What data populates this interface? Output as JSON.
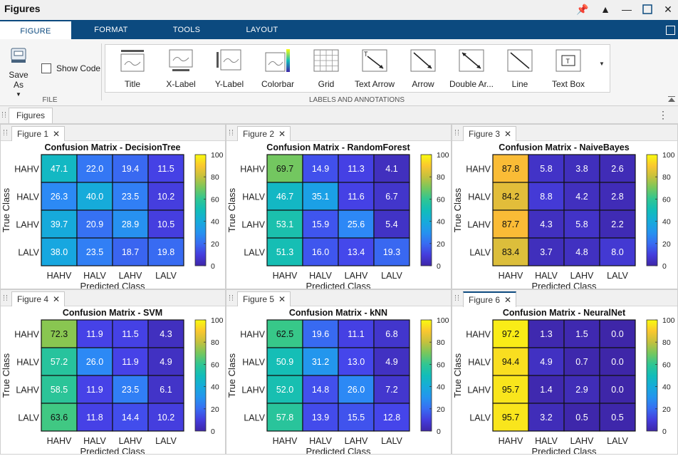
{
  "window": {
    "title": "Figures"
  },
  "tabs": [
    {
      "label": "FIGURE",
      "active": true
    },
    {
      "label": "FORMAT",
      "active": false
    },
    {
      "label": "TOOLS",
      "active": false
    },
    {
      "label": "LAYOUT",
      "active": false
    }
  ],
  "ribbon": {
    "save_as": "Save As",
    "show_code": "Show Code",
    "file_group": "FILE",
    "annotations_group": "LABELS AND ANNOTATIONS",
    "gallery": [
      "Title",
      "X-Label",
      "Y-Label",
      "Colorbar",
      "Grid",
      "Text Arrow",
      "Arrow",
      "Double Ar...",
      "Line",
      "Text Box"
    ]
  },
  "document_tab": "Figures",
  "colors": {
    "accent": "#0c4a7f",
    "cell_border": "#111111"
  },
  "colormap": "parula",
  "chart_data": [
    {
      "figure_tab": "Figure 1",
      "type": "heatmap",
      "title": "Confusion Matrix - DecisionTree",
      "xlabel": "Predicted Class",
      "ylabel": "True Class",
      "x_categories": [
        "HAHV",
        "HALV",
        "LAHV",
        "LALV"
      ],
      "y_categories": [
        "HAHV",
        "HALV",
        "LAHV",
        "LALV"
      ],
      "values": [
        [
          47.1,
          22.0,
          19.4,
          11.5
        ],
        [
          26.3,
          40.0,
          23.5,
          10.2
        ],
        [
          39.7,
          20.9,
          28.9,
          10.5
        ],
        [
          38.0,
          23.5,
          18.7,
          19.8
        ]
      ],
      "colorbar_ticks": [
        "100",
        "80",
        "60",
        "40",
        "20",
        "0"
      ],
      "clim": [
        0,
        100
      ]
    },
    {
      "figure_tab": "Figure 2",
      "type": "heatmap",
      "title": "Confusion Matrix - RandomForest",
      "xlabel": "Predicted Class",
      "ylabel": "True Class",
      "x_categories": [
        "HAHV",
        "HALV",
        "LAHV",
        "LALV"
      ],
      "y_categories": [
        "HAHV",
        "HALV",
        "LAHV",
        "LALV"
      ],
      "values": [
        [
          69.7,
          14.9,
          11.3,
          4.1
        ],
        [
          46.7,
          35.1,
          11.6,
          6.7
        ],
        [
          53.1,
          15.9,
          25.6,
          5.4
        ],
        [
          51.3,
          16.0,
          13.4,
          19.3
        ]
      ],
      "colorbar_ticks": [
        "100",
        "80",
        "60",
        "40",
        "20",
        "0"
      ],
      "clim": [
        0,
        100
      ]
    },
    {
      "figure_tab": "Figure 3",
      "type": "heatmap",
      "title": "Confusion Matrix - NaiveBayes",
      "xlabel": "Predicted Class",
      "ylabel": "True Class",
      "x_categories": [
        "HAHV",
        "HALV",
        "LAHV",
        "LALV"
      ],
      "y_categories": [
        "HAHV",
        "HALV",
        "LAHV",
        "LALV"
      ],
      "values": [
        [
          87.8,
          5.8,
          3.8,
          2.6
        ],
        [
          84.2,
          8.8,
          4.2,
          2.8
        ],
        [
          87.7,
          4.3,
          5.8,
          2.2
        ],
        [
          83.4,
          3.7,
          4.8,
          8.0
        ]
      ],
      "colorbar_ticks": [
        "100",
        "80",
        "60",
        "40",
        "20",
        "0"
      ],
      "clim": [
        0,
        100
      ]
    },
    {
      "figure_tab": "Figure 4",
      "type": "heatmap",
      "title": "Confusion Matrix - SVM",
      "xlabel": "Predicted Class",
      "ylabel": "True Class",
      "x_categories": [
        "HAHV",
        "HALV",
        "LAHV",
        "LALV"
      ],
      "y_categories": [
        "HAHV",
        "HALV",
        "LAHV",
        "LALV"
      ],
      "values": [
        [
          72.3,
          11.9,
          11.5,
          4.3
        ],
        [
          57.2,
          26.0,
          11.9,
          4.9
        ],
        [
          58.5,
          11.9,
          23.5,
          6.1
        ],
        [
          63.6,
          11.8,
          14.4,
          10.2
        ]
      ],
      "colorbar_ticks": [
        "100",
        "80",
        "60",
        "40",
        "20",
        "0"
      ],
      "clim": [
        0,
        100
      ]
    },
    {
      "figure_tab": "Figure 5",
      "type": "heatmap",
      "title": "Confusion Matrix - kNN",
      "xlabel": "Predicted Class",
      "ylabel": "True Class",
      "x_categories": [
        "HAHV",
        "HALV",
        "LAHV",
        "LALV"
      ],
      "y_categories": [
        "HAHV",
        "HALV",
        "LAHV",
        "LALV"
      ],
      "values": [
        [
          62.5,
          19.6,
          11.1,
          6.8
        ],
        [
          50.9,
          31.2,
          13.0,
          4.9
        ],
        [
          52.0,
          14.8,
          26.0,
          7.2
        ],
        [
          57.8,
          13.9,
          15.5,
          12.8
        ]
      ],
      "colorbar_ticks": [
        "100",
        "80",
        "60",
        "40",
        "20",
        "0"
      ],
      "clim": [
        0,
        100
      ]
    },
    {
      "figure_tab": "Figure 6",
      "type": "heatmap",
      "title": "Confusion Matrix - NeuralNet",
      "xlabel": "Predicted Class",
      "ylabel": "True Class",
      "x_categories": [
        "HAHV",
        "HALV",
        "LAHV",
        "LALV"
      ],
      "y_categories": [
        "HAHV",
        "HALV",
        "LAHV",
        "LALV"
      ],
      "values": [
        [
          97.2,
          1.3,
          1.5,
          0.0
        ],
        [
          94.4,
          4.9,
          0.7,
          0.0
        ],
        [
          95.7,
          1.4,
          2.9,
          0.0
        ],
        [
          95.7,
          3.2,
          0.5,
          0.5
        ]
      ],
      "colorbar_ticks": [
        "100",
        "80",
        "60",
        "40",
        "20",
        "0"
      ],
      "clim": [
        0,
        100
      ]
    }
  ]
}
